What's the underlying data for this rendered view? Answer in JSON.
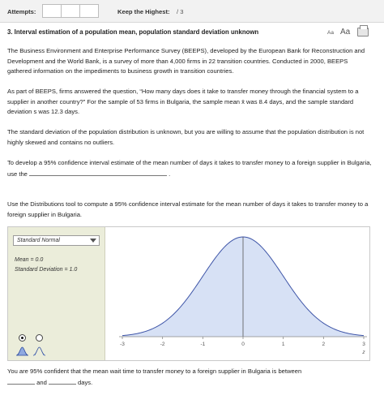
{
  "header": {
    "attempts_label": "Attempts:",
    "keep_label": "Keep the Highest:",
    "keep_value": "/ 3"
  },
  "question": {
    "title": "3.  Interval estimation of a population mean, population standard deviation unknown",
    "font_small": "Aa",
    "font_large": "Aa",
    "p1": "The Business Environment and Enterprise Performance Survey (BEEPS), developed by the European Bank for Reconstruction and Development and the World Bank, is a survey of more than 4,000 firms in 22 transition countries. Conducted in 2000, BEEPS gathered information on the impediments to business growth in transition countries.",
    "p2": "As part of BEEPS, firms answered the question, “How many days does it take to transfer money through the financial system to a supplier in another country?” For the sample of 53 firms in Bulgaria, the sample mean x̄ was 8.4 days, and the sample standard deviation s was 12.3 days.",
    "p3": "The standard deviation of the population distribution is unknown, but you are willing to assume that the population distribution is not highly skewed and contains no outliers.",
    "p4_pre": "To develop a 95% confidence interval estimate of the mean number of days it takes to transfer money to a foreign supplier in Bulgaria, use the",
    "p4_post": ".",
    "p5": "Use the Distributions tool to compute a 95% confidence interval estimate for the mean number of days it takes to transfer money to a foreign supplier in Bulgaria."
  },
  "tool": {
    "distribution_selected": "Standard Normal",
    "mean_text": "Mean = 0.0",
    "sd_text": "Standard Deviation = 1.0",
    "axis_label": "z",
    "fill_color": "#d7e1f5",
    "line_color": "#3f56a8",
    "chart_data": {
      "type": "area",
      "title": "",
      "xlabel": "z",
      "ylabel": "",
      "xlim": [
        -3,
        3
      ],
      "x_ticks": [
        "-3",
        "-2",
        "-1",
        "0",
        "1",
        "2",
        "3"
      ],
      "mean": 0.0,
      "sd": 1.0,
      "series": [
        {
          "x": [
            -3,
            -2.5,
            -2,
            -1.5,
            -1,
            -0.5,
            0,
            0.5,
            1,
            1.5,
            2,
            2.5,
            3
          ],
          "values": [
            0.0044,
            0.0175,
            0.054,
            0.1295,
            0.242,
            0.3521,
            0.3989,
            0.3521,
            0.242,
            0.1295,
            0.054,
            0.0175,
            0.0044
          ]
        }
      ]
    }
  },
  "footer": {
    "pre": "You are 95% confident that the mean wait time to transfer money to a foreign supplier in Bulgaria is between",
    "and": "and",
    "days": "days."
  }
}
